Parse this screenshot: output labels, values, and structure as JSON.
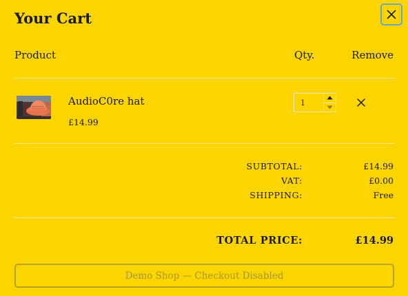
{
  "cart": {
    "title": "Your Cart",
    "close_label": "×"
  },
  "columns": {
    "product": "Product",
    "qty": "Qty.",
    "remove": "Remove"
  },
  "items": [
    {
      "name": "AudioC0re hat",
      "price": "£14.99",
      "quantity": "1",
      "thumbnail": "product-thumbnail"
    }
  ],
  "summary": {
    "subtotal_label": "SUBTOTAL:",
    "subtotal_value": "£14.99",
    "vat_label": "VAT:",
    "vat_value": "£0.00",
    "shipping_label": "SHIPPING:",
    "shipping_value": "Free"
  },
  "total": {
    "label": "TOTAL PRICE:",
    "value": "£14.99"
  },
  "checkout": {
    "label": "Demo Shop — Checkout Disabled",
    "disabled": true
  },
  "colors": {
    "background": "#FCD500",
    "text": "#1a1a1a",
    "focus_ring": "#6aa7c8",
    "disabled_border": "#b9a21c",
    "disabled_text": "#a8962f"
  },
  "icons": {
    "close": "close-icon",
    "remove": "remove-x-icon",
    "step_up": "caret-up-icon",
    "step_down": "caret-down-icon"
  }
}
